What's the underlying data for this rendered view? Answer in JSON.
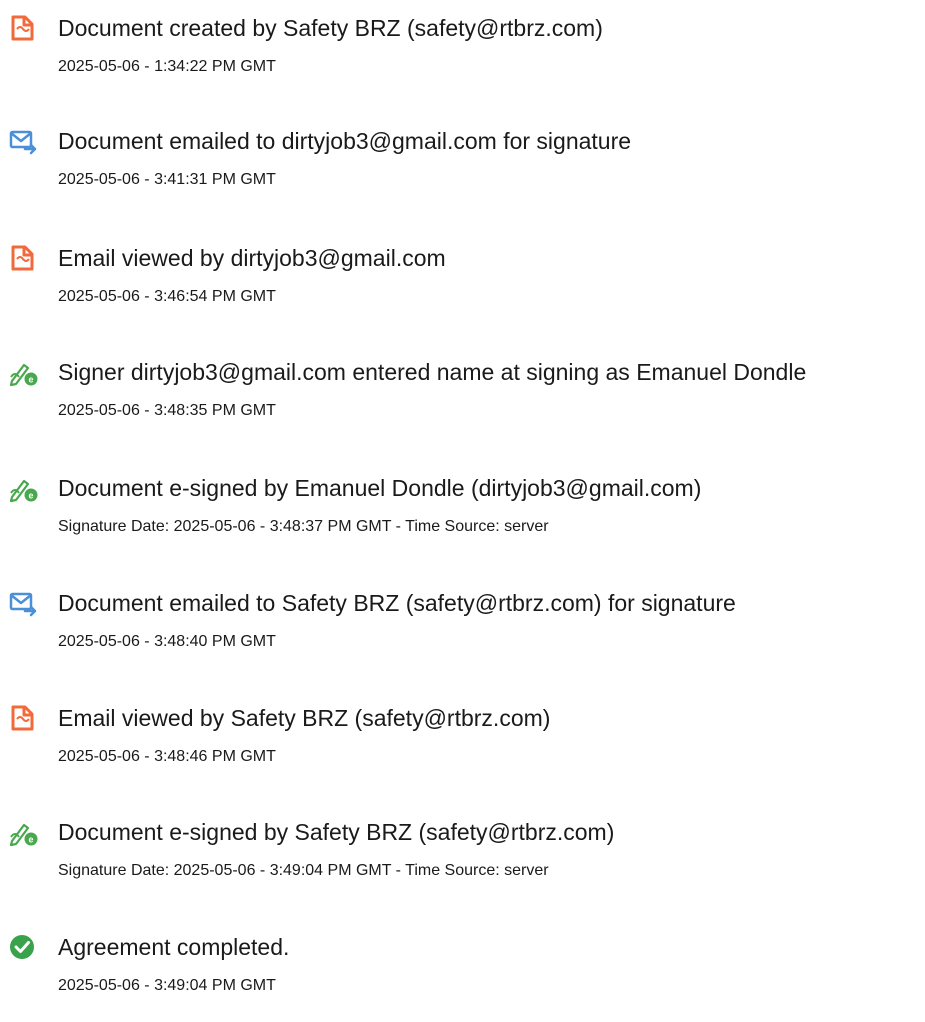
{
  "icon_colors": {
    "document": "#f26a3a",
    "email": "#4a90d9",
    "esign": "#49a84e",
    "completed": "#3aa24a"
  },
  "events": [
    {
      "icon": "document-icon",
      "title": "Document created by Safety BRZ (safety@rtbrz.com)",
      "subtitle": "2025-05-06 - 1:34:22 PM GMT"
    },
    {
      "icon": "email-send-icon",
      "title": "Document emailed to dirtyjob3@gmail.com for signature",
      "subtitle": "2025-05-06 - 3:41:31 PM GMT"
    },
    {
      "icon": "document-icon",
      "title": "Email viewed by dirtyjob3@gmail.com",
      "subtitle": "2025-05-06 - 3:46:54 PM GMT"
    },
    {
      "icon": "signature-pen-icon",
      "title": "Signer dirtyjob3@gmail.com entered name at signing as Emanuel Dondle",
      "subtitle": "2025-05-06 - 3:48:35 PM GMT"
    },
    {
      "icon": "signature-pen-icon",
      "title": "Document e-signed by Emanuel Dondle (dirtyjob3@gmail.com)",
      "subtitle": "Signature Date: 2025-05-06 - 3:48:37 PM GMT - Time Source: server"
    },
    {
      "icon": "email-send-icon",
      "title": "Document emailed to Safety BRZ (safety@rtbrz.com) for signature",
      "subtitle": "2025-05-06 - 3:48:40 PM GMT"
    },
    {
      "icon": "document-icon",
      "title": "Email viewed by Safety BRZ (safety@rtbrz.com)",
      "subtitle": "2025-05-06 - 3:48:46 PM GMT"
    },
    {
      "icon": "signature-pen-icon",
      "title": "Document e-signed by Safety BRZ (safety@rtbrz.com)",
      "subtitle": "Signature Date: 2025-05-06 - 3:49:04 PM GMT - Time Source: server"
    },
    {
      "icon": "check-circle-icon",
      "title": "Agreement completed.",
      "subtitle": "2025-05-06 - 3:49:04 PM GMT"
    }
  ]
}
